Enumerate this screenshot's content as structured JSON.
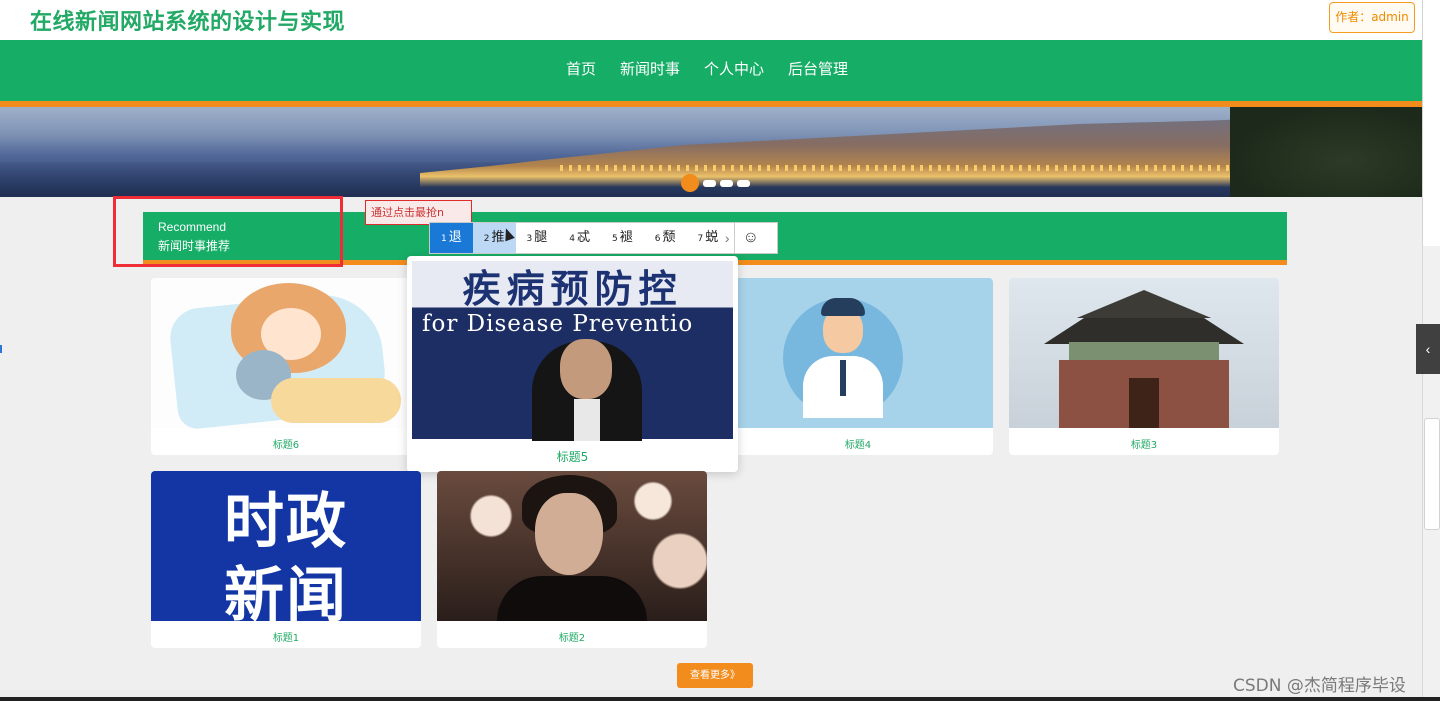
{
  "header": {
    "site_title": "在线新闻网站系统的设计与实现",
    "author_label": "作者：admin"
  },
  "nav": {
    "items": [
      "首页",
      "新闻时事",
      "个人中心",
      "后台管理"
    ]
  },
  "banner": {
    "slide_count": 4,
    "active_slide": 1
  },
  "recommend": {
    "title_en": "Recommend",
    "title_cn": "新闻时事推荐"
  },
  "ime": {
    "composition": "通过点击最抢n",
    "candidates": [
      {
        "num": "1",
        "char": "退"
      },
      {
        "num": "2",
        "char": "推"
      },
      {
        "num": "3",
        "char": "腿"
      },
      {
        "num": "4",
        "char": "忒"
      },
      {
        "num": "5",
        "char": "褪"
      },
      {
        "num": "6",
        "char": "颓"
      },
      {
        "num": "7",
        "char": "蜕"
      }
    ],
    "next_icon": "chevron-right-icon",
    "emoji_icon": "☺"
  },
  "cards": [
    {
      "caption": "标题6",
      "image": "sleeping-girl-illustration"
    },
    {
      "caption": "标题5",
      "image": "press-conference-photo",
      "press_line1": "疾病预防控",
      "press_line2": "for Disease Preventio"
    },
    {
      "caption": "标题4",
      "image": "doctor-illustration"
    },
    {
      "caption": "标题3",
      "image": "chinese-pavilion-photo"
    },
    {
      "caption": "标题1",
      "image": "political-news-graphic",
      "line1": "时政",
      "line2": "新闻"
    },
    {
      "caption": "标题2",
      "image": "young-man-portrait"
    }
  ],
  "more_button": "查看更多》",
  "sidebar": {
    "toggle_icon": "‹"
  },
  "watermark": "CSDN @杰简程序毕设",
  "colors": {
    "brand_green": "#16ad67",
    "accent_orange": "#f28c1c",
    "highlight_red": "#ef2d36",
    "ime_selected": "#1a78d6"
  }
}
